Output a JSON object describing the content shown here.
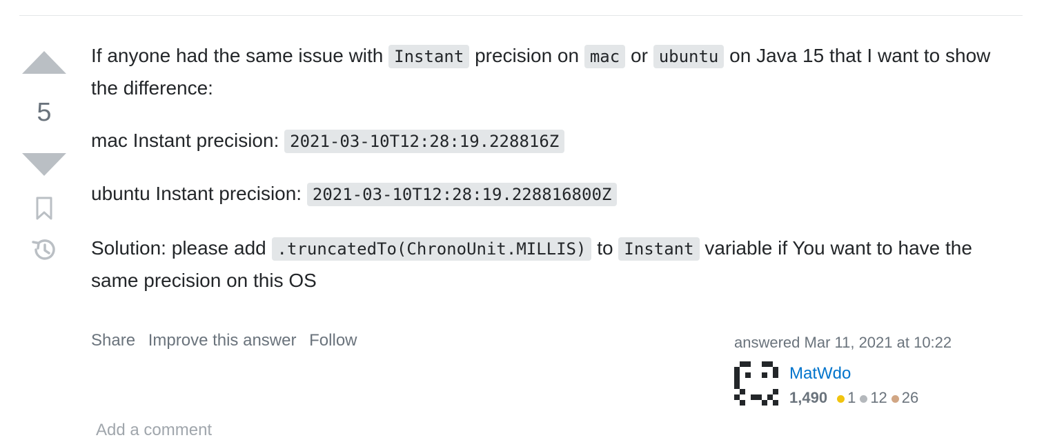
{
  "vote": {
    "score": "5"
  },
  "post": {
    "p1_a": "If anyone had the same issue with ",
    "p1_code1": "Instant",
    "p1_b": " precision on ",
    "p1_code2": "mac",
    "p1_c": " or ",
    "p1_code3": "ubuntu",
    "p1_d": " on Java 15 that I want to show the difference:",
    "p2_label": "mac Instant precision: ",
    "p2_code": "2021-03-10T12:28:19.228816Z",
    "p3_label": "ubuntu Instant precision: ",
    "p3_code": "2021-03-10T12:28:19.228816800Z",
    "p4_a": "Solution: please add ",
    "p4_code1": ".truncatedTo(ChronoUnit.MILLIS)",
    "p4_b": " to ",
    "p4_code2": "Instant",
    "p4_c": " variable if You want to have the same precision on this OS"
  },
  "menu": {
    "share": "Share",
    "improve": "Improve this answer",
    "follow": "Follow"
  },
  "user": {
    "answered": "answered Mar 11, 2021 at 10:22",
    "name": "MatWdo",
    "reputation": "1,490",
    "gold": "1",
    "silver": "12",
    "bronze": "26"
  },
  "comment": {
    "add": "Add a comment"
  },
  "icons": [
    "upvote-arrow-icon",
    "downvote-arrow-icon",
    "bookmark-icon",
    "history-icon",
    "identicon-avatar"
  ]
}
